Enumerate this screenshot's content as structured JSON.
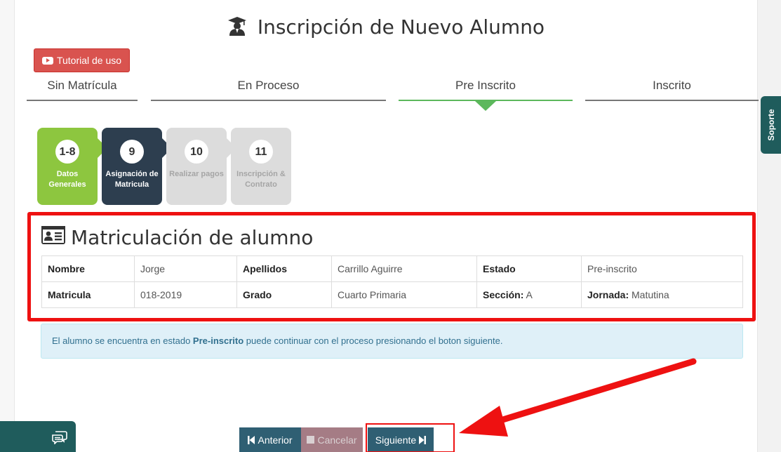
{
  "page": {
    "title": "Inscripción de Nuevo Alumno",
    "tutorial_button": "Tutorial de uso"
  },
  "stages": [
    {
      "label": "Sin Matrícula",
      "active": false
    },
    {
      "label": "En Proceso",
      "active": false
    },
    {
      "label": "Pre Inscrito",
      "active": true
    },
    {
      "label": "Inscrito",
      "active": false
    }
  ],
  "steps": [
    {
      "number": "1-8",
      "label": "Datos Generales",
      "state": "done"
    },
    {
      "number": "9",
      "label": "Asignación de Matricula",
      "state": "current"
    },
    {
      "number": "10",
      "label": "Realizar pagos",
      "state": "pending"
    },
    {
      "number": "11",
      "label": "Inscripción & Contrato",
      "state": "pending"
    }
  ],
  "card": {
    "title": "Matriculación de alumno",
    "rows": [
      [
        {
          "key": "Nombre",
          "value": "Jorge"
        },
        {
          "key": "Apellidos",
          "value": "Carrillo Aguirre"
        },
        {
          "key": "Estado",
          "value": "Pre-inscrito"
        }
      ],
      [
        {
          "key": "Matricula",
          "value": "018-2019"
        },
        {
          "key": "Grado",
          "value": "Cuarto Primaria"
        },
        {
          "key": "Sección:",
          "value": "A"
        },
        {
          "key": "Jornada:",
          "value": "Matutina"
        }
      ]
    ]
  },
  "alert": {
    "prefix": "El alumno se encuentra en estado ",
    "status": "Pre-inscrito",
    "suffix": " puede continuar con el proceso presionando el boton siguiente."
  },
  "buttons": {
    "previous": "Anterior",
    "cancel": "Cancelar",
    "next": "Siguiente"
  },
  "sidebar": {
    "support_tab": "Soporte"
  },
  "colors": {
    "done": "#8dc63f",
    "current": "#2d3e4f",
    "pending": "#dcdcdc",
    "highlight": "#ee1111",
    "nav_button": "#2f5f73"
  }
}
